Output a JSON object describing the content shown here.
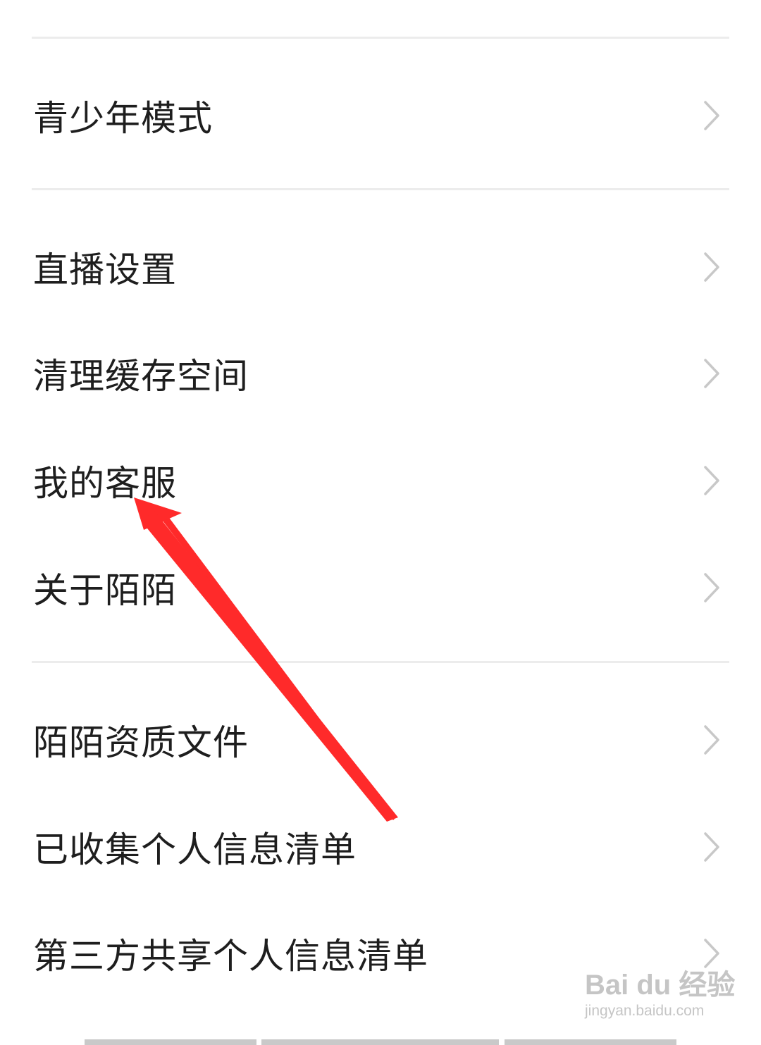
{
  "menu": {
    "items": [
      {
        "label": "青少年模式"
      },
      {
        "label": "直播设置"
      },
      {
        "label": "清理缓存空间"
      },
      {
        "label": "我的客服"
      },
      {
        "label": "关于陌陌"
      },
      {
        "label": "陌陌资质文件"
      },
      {
        "label": "已收集个人信息清单"
      },
      {
        "label": "第三方共享个人信息清单"
      }
    ],
    "chevron_icon": "chevron-right-icon"
  },
  "annotation": {
    "color": "#ff2a2a",
    "points_to": "我的客服"
  },
  "watermark": {
    "main": "Bai du 经验",
    "sub": "jingyan.baidu.com"
  },
  "colors": {
    "background": "#ffffff",
    "text": "#1e1e1e",
    "divider": "#ececec",
    "chevron": "#c8c8c8"
  }
}
